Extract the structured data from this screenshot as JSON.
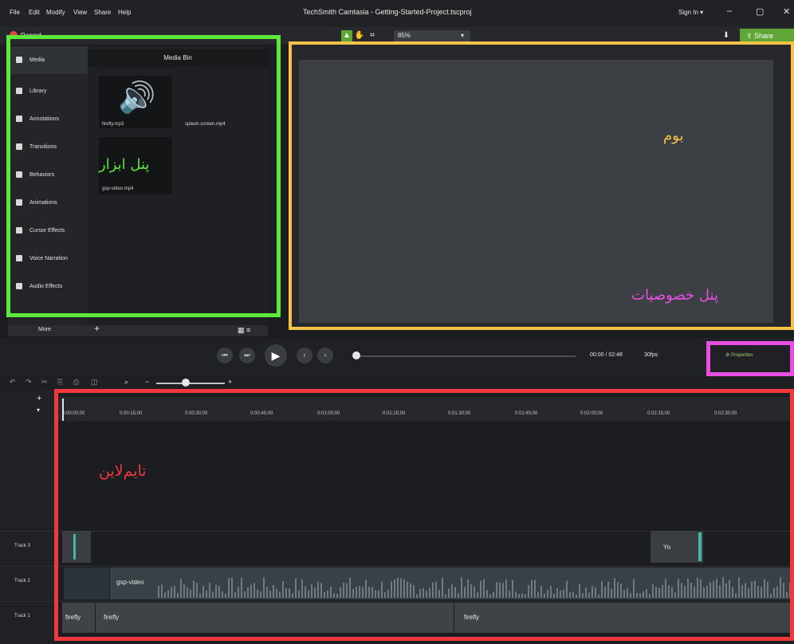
{
  "menubar": {
    "items": [
      "File",
      "Edit",
      "Modify",
      "View",
      "Share",
      "Help"
    ]
  },
  "window": {
    "title": "TechSmith Camtasia - Getting-Started-Project.tscproj",
    "sign_in": "Sign In ▾",
    "minimize": "–",
    "maximize": "▢",
    "close": "✕"
  },
  "toolbar": {
    "record_label": "Record",
    "zoom_value": "85%",
    "share_label": "Share",
    "icons": {
      "select": "arrow-pointer-icon",
      "hand": "hand-icon",
      "crop": "crop-icon"
    }
  },
  "tools_panel": {
    "items": [
      "Media",
      "Library",
      "Annotations",
      "Transitions",
      "Behaviors",
      "Animations",
      "Cursor Effects",
      "Voice Narration",
      "Audio Effects"
    ],
    "active": "Media",
    "more_label": "More"
  },
  "media_bin": {
    "title": "Media Bin",
    "files": [
      "firefly.mp3",
      "splash-screen.mp4",
      "gsp-video.mp4"
    ]
  },
  "playback": {
    "time": "00:00 / 02:48",
    "fps": "30fps",
    "properties_label": "Properties"
  },
  "timeline": {
    "ruler_labels": [
      "0:00:00;00",
      "0:00:15;00",
      "0:00:30;00",
      "0:00:45;00",
      "0:01:00;00",
      "0:01:15;00",
      "0:01:30;00",
      "0:01:45;00",
      "0:02:00;00",
      "0:02:15;00",
      "0:02:30;00"
    ],
    "tracks": [
      "Track 3",
      "Track 2",
      "Track 1"
    ],
    "clips": {
      "video": "gsp-video",
      "audio_a": "firefly",
      "audio_b": "firefly",
      "audio_c": "firefly",
      "t3_b": "Yo"
    }
  },
  "annotations": {
    "tools": "پنل ابزار",
    "canvas": "بوم",
    "properties": "پنل خصوصیات",
    "timeline": "تایم‌لاین",
    "colors": {
      "tools": "#5bea3c",
      "canvas": "#f5c24a",
      "properties": "#e94ee3",
      "timeline": "#f0383d"
    }
  }
}
